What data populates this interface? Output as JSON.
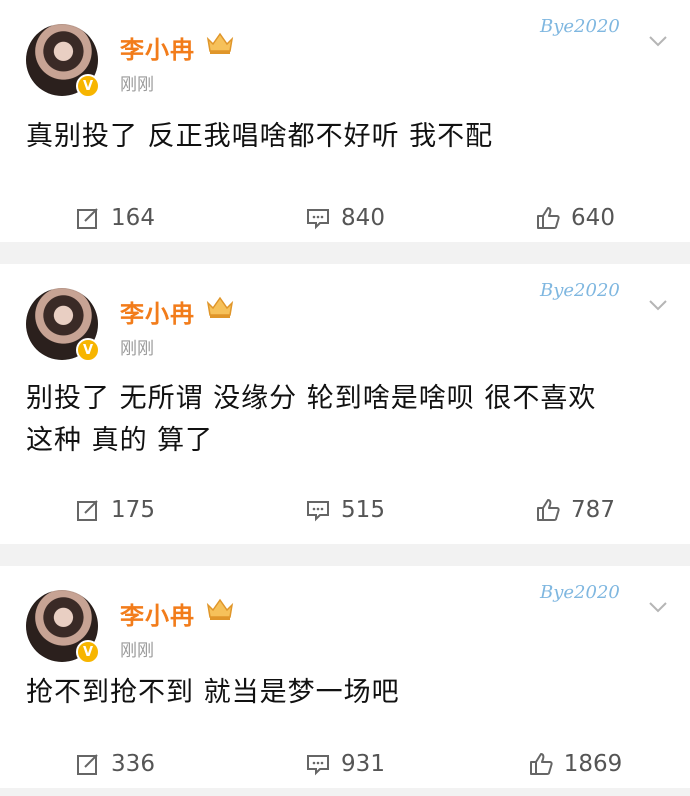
{
  "posts": [
    {
      "name": "李小冉",
      "time": "刚刚",
      "watermark": "Bye2020",
      "text_lines": [
        "真别投了 反正我唱啥都不好听 我不配"
      ],
      "repost": "164",
      "comment": "840",
      "like": "640"
    },
    {
      "name": "李小冉",
      "time": "刚刚",
      "watermark": "Bye2020",
      "text_lines": [
        "别投了 无所谓 没缘分 轮到啥是啥呗 很不喜欢",
        "这种 真的 算了"
      ],
      "repost": "175",
      "comment": "515",
      "like": "787"
    },
    {
      "name": "李小冉",
      "time": "刚刚",
      "watermark": "Bye2020",
      "text_lines": [
        "抢不到抢不到 就当是梦一场吧"
      ],
      "repost": "336",
      "comment": "931",
      "like": "1869"
    }
  ],
  "icons": {
    "repost": "share-edit-icon",
    "comment": "comment-icon",
    "like": "thumbs-up-icon",
    "verified": "verified-v-icon",
    "crown": "crown-icon",
    "more": "chevron-down-icon"
  },
  "colors": {
    "name": "#f27c1a",
    "verified": "#f7b500",
    "background": "#f2f2f2"
  }
}
